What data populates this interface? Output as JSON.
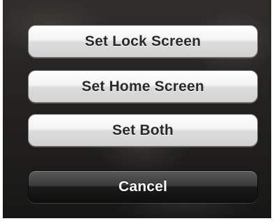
{
  "action_sheet": {
    "set_lock_screen_label": "Set Lock Screen",
    "set_home_screen_label": "Set Home Screen",
    "set_both_label": "Set Both",
    "cancel_label": "Cancel"
  },
  "colors": {
    "light_button_text": "#2a2a2a",
    "dark_button_text": "#ffffff",
    "backdrop": "#2e2c29"
  }
}
